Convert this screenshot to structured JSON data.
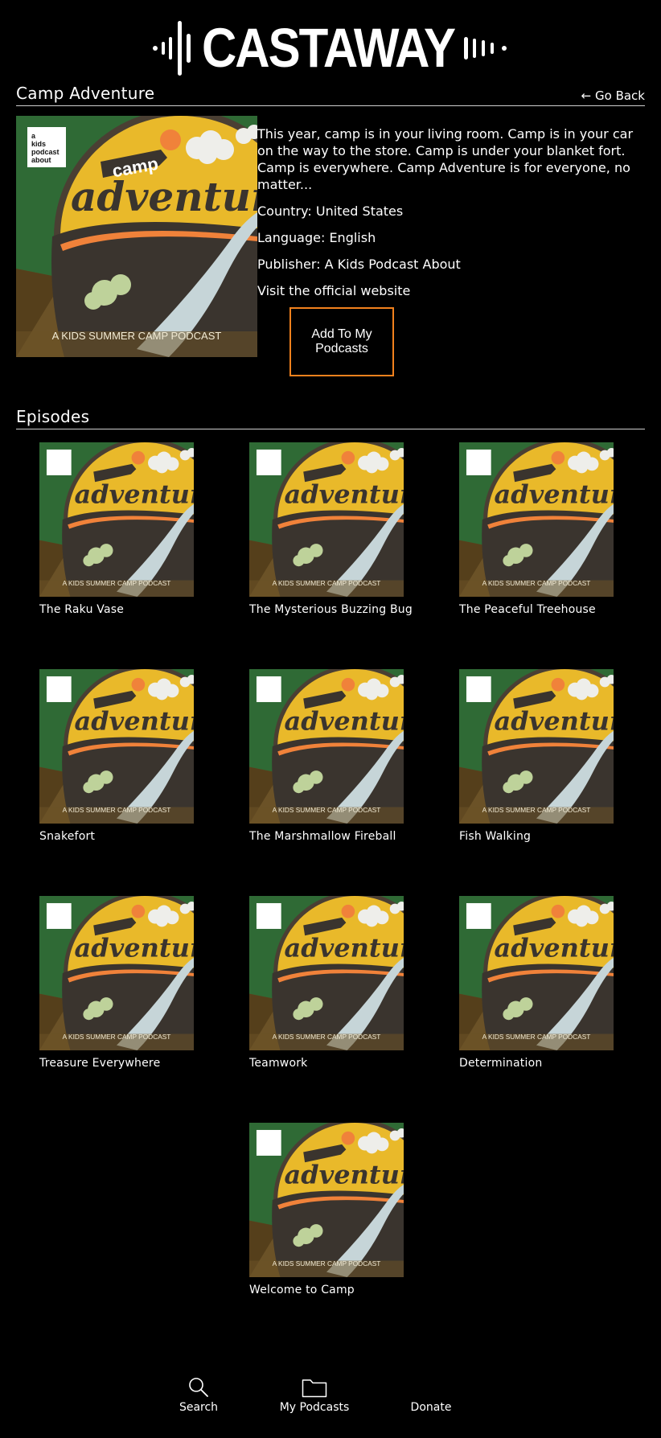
{
  "app": {
    "logo_text": "CASTAWAY"
  },
  "podcast": {
    "title": "Camp Adventure",
    "go_back_label": "← Go Back",
    "description": "This year, camp is in your living room. Camp is in your car on the way to the store. Camp is under your blanket fort. Camp is everywhere. Camp Adventure is for everyone, no matter...",
    "country": "Country: United States",
    "language": "Language: English",
    "publisher": "Publisher: A Kids Podcast About",
    "website_label": "Visit the official website",
    "add_button_label": "Add To My Podcasts"
  },
  "artwork": {
    "badge_line1": "a",
    "badge_line2": "kids",
    "badge_line3": "podcast",
    "badge_line4": "about",
    "word1": "camp",
    "word2": "adventure",
    "caption": "A KIDS SUMMER CAMP PODCAST"
  },
  "episodes_section": {
    "title": "Episodes"
  },
  "episodes": [
    {
      "title": "The Raku Vase"
    },
    {
      "title": "The Mysterious Buzzing Bug"
    },
    {
      "title": "The Peaceful Treehouse"
    },
    {
      "title": "Snakefort"
    },
    {
      "title": "The Marshmallow Fireball"
    },
    {
      "title": "Fish Walking"
    },
    {
      "title": "Treasure Everywhere"
    },
    {
      "title": "Teamwork"
    },
    {
      "title": "Determination"
    },
    {
      "title": "Welcome to Camp"
    }
  ],
  "nav": {
    "items": [
      {
        "label": "Search",
        "icon": "search-icon"
      },
      {
        "label": "My Podcasts",
        "icon": "folder-icon"
      },
      {
        "label": "Donate",
        "icon": ""
      }
    ]
  },
  "colors": {
    "background": "#000000",
    "accent": "#f2811d",
    "art_yellow": "#e9b92a",
    "art_green": "#2f6a35",
    "art_brown": "#6b5227"
  }
}
